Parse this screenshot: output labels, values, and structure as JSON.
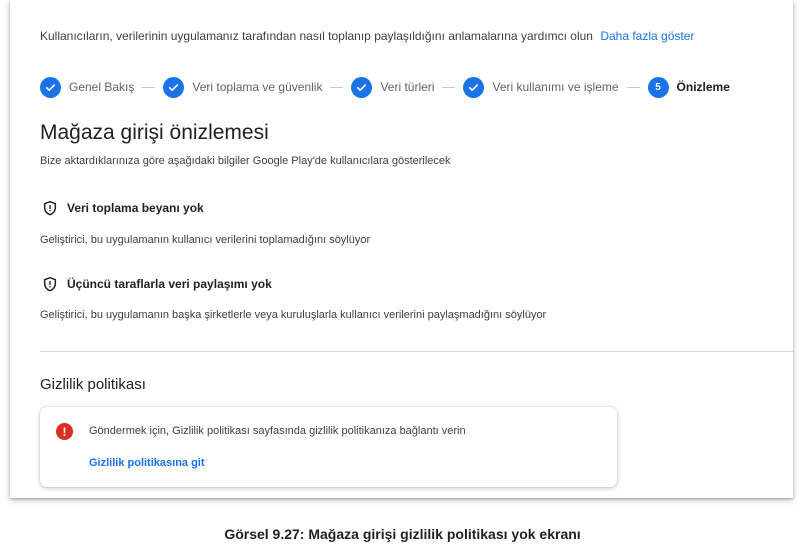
{
  "intro": {
    "text": "Kullanıcıların, verilerinin uygulamanız tarafından nasıl toplanıp paylaşıldığını anlamalarına yardımcı olun",
    "link": "Daha fazla göster"
  },
  "stepper": {
    "steps": [
      {
        "label": "Genel Bakış",
        "state": "done"
      },
      {
        "label": "Veri toplama ve güvenlik",
        "state": "done"
      },
      {
        "label": "Veri türleri",
        "state": "done"
      },
      {
        "label": "Veri kullanımı ve işleme",
        "state": "done"
      },
      {
        "label": "Önizleme",
        "state": "active",
        "number": "5"
      }
    ]
  },
  "main": {
    "title": "Mağaza girişi önizlemesi",
    "subtitle": "Bize aktardıklarınıza göre aşağıdaki bilgiler Google Play'de kullanıcılara gösterilecek",
    "sections": [
      {
        "title": "Veri toplama beyanı yok",
        "description": "Geliştirici, bu uygulamanın kullanıcı verilerini toplamadığını söylüyor"
      },
      {
        "title": "Üçüncü taraflarla veri paylaşımı yok",
        "description": "Geliştirici, bu uygulamanın başka şirketlerle veya kuruluşlarla kullanıcı verilerini paylaşmadığını söylüyor"
      }
    ]
  },
  "privacy": {
    "heading": "Gizlilik politikası",
    "alert_icon": "!",
    "alert_text": "Göndermek için, Gizlilik politikası sayfasında gizlilik politikanıza bağlantı verin",
    "link": "Gizlilik politikasına git"
  },
  "caption": "Görsel 9.27: Mağaza girişi gizlilik politikası yok ekranı",
  "colors": {
    "accent": "#1a73e8",
    "error": "#d93025"
  }
}
